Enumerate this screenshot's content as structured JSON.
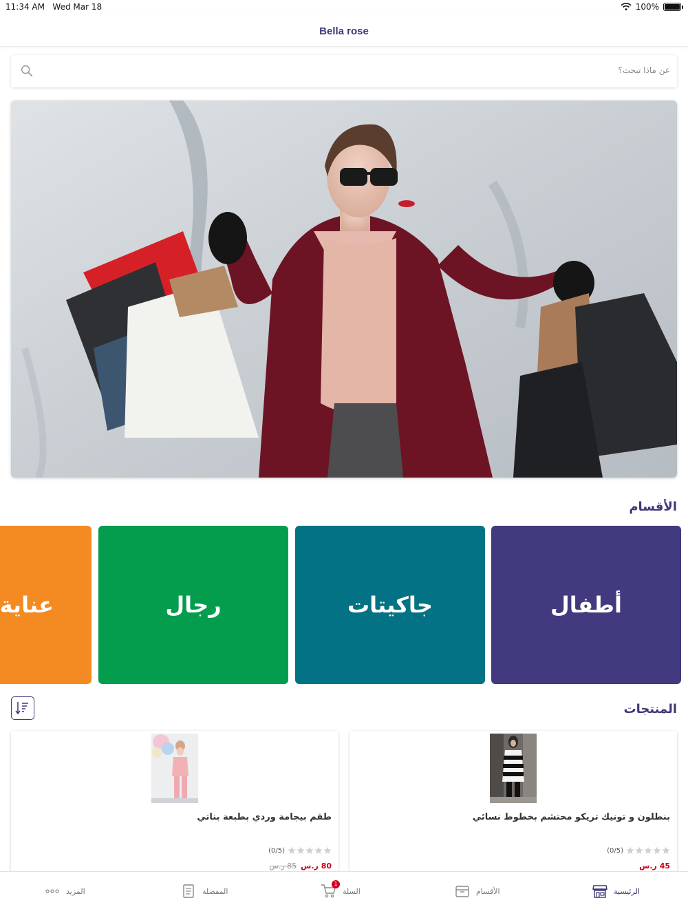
{
  "status_bar": {
    "time": "11:34 AM",
    "date": "Wed Mar 18",
    "battery": "100%",
    "battery_level": 1.0
  },
  "header": {
    "title": "Bella rose"
  },
  "search": {
    "placeholder": "عن ماذا تبحث؟"
  },
  "banner": {
    "image": "woman-with-shopping-bags"
  },
  "categories": {
    "title": "الأقسام",
    "items": [
      {
        "label": "أطفال",
        "color": "#413a7e"
      },
      {
        "label": "جاكيتات",
        "color": "#037284"
      },
      {
        "label": "رجال",
        "color": "#039d4d"
      },
      {
        "label": "عناية",
        "color": "#f38a22"
      }
    ]
  },
  "products": {
    "title": "المنتجات",
    "sort_icon": "sort-icon",
    "items": [
      {
        "name": "بنطلون و تونيك تريكو محتشم بخطوط نسائي",
        "rating": "(0/5)",
        "price": "45 ر.س",
        "old_price": ""
      },
      {
        "name": "طقم بيجامة وردي بطبعة بناتي",
        "rating": "(0/5)",
        "price": "80 ر.س",
        "old_price": "85 ر.س"
      }
    ]
  },
  "tab_bar": {
    "items": [
      {
        "label": "الرئيسية",
        "icon": "store-icon",
        "active": true
      },
      {
        "label": "الأقسام",
        "icon": "box-icon"
      },
      {
        "label": "السلة",
        "icon": "cart-icon",
        "badge": "1"
      },
      {
        "label": "المفضلة",
        "icon": "list-icon"
      },
      {
        "label": "المزيد",
        "icon": "more-icon"
      }
    ]
  },
  "colors": {
    "brand": "#3e3878",
    "price": "#d0021b"
  }
}
